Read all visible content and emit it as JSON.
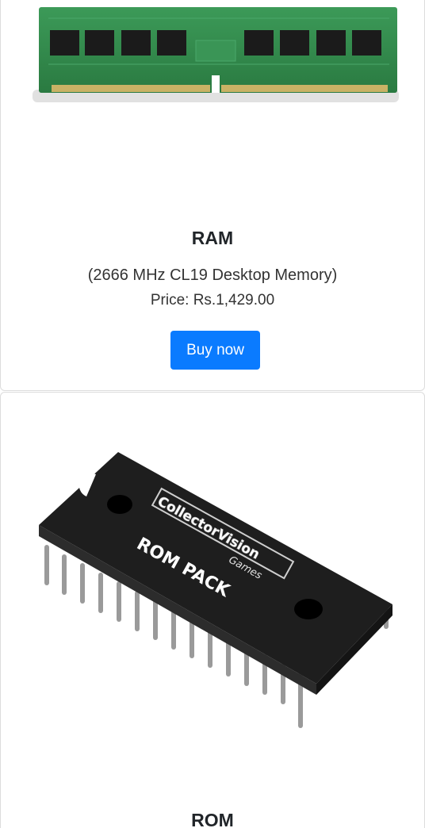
{
  "products": [
    {
      "image_icon": "ram-module-image",
      "name": "RAM",
      "description": "(2666 MHz CL19 Desktop Memory)",
      "price": "Price: Rs.1,429.00",
      "button_label": "Buy now"
    },
    {
      "image_icon": "rom-chip-image",
      "image_text_brand": "CollectorVision",
      "image_text_sub": "Games",
      "image_text_label": "ROM PACK",
      "name": "ROM"
    }
  ],
  "colors": {
    "button_bg": "#0a7bff",
    "pcb_green": "#2f8a4a",
    "chip_black": "#1e1e1e"
  }
}
